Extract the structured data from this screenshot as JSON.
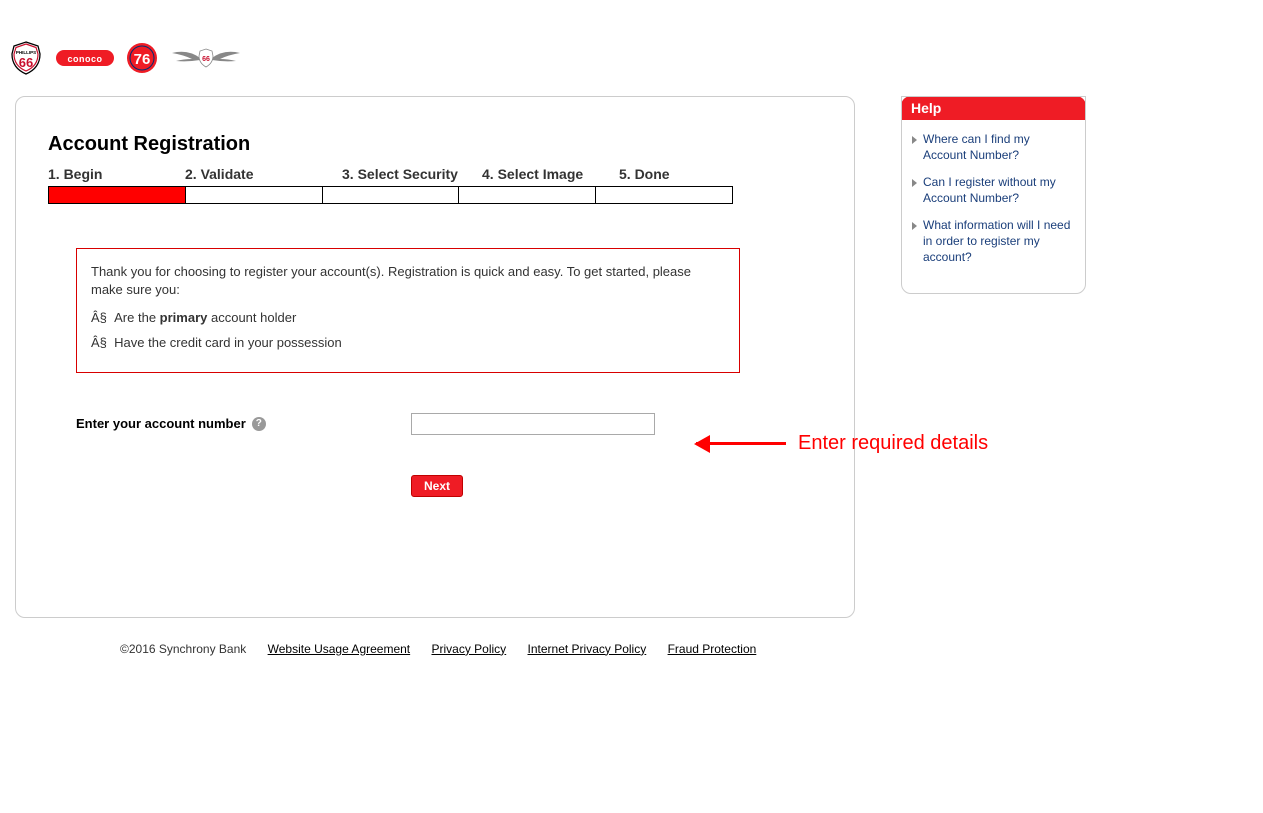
{
  "logos": {
    "phillips66_alt": "Phillips 66",
    "conoco_alt": "Conoco",
    "seventysix_alt": "76",
    "wings_alt": "Phillips 66 Aviation"
  },
  "page": {
    "title": "Account Registration"
  },
  "steps": {
    "items": [
      {
        "label": "1. Begin"
      },
      {
        "label": "2. Validate"
      },
      {
        "label": "3. Select Security"
      },
      {
        "label": "4. Select Image"
      },
      {
        "label": "5. Done"
      }
    ],
    "active_index": 0
  },
  "info": {
    "intro": "Thank you for choosing to register your account(s). Registration is quick and easy. To get started, please make sure you:",
    "bullet_prefix": "Â§",
    "item1_pre": "Are the ",
    "item1_bold": "primary",
    "item1_post": " account holder",
    "item2": "Have the credit card in your possession"
  },
  "form": {
    "account_label": "Enter your account number",
    "account_value": "",
    "next_label": "Next"
  },
  "help": {
    "title": "Help",
    "links": [
      {
        "text": "Where can I find my Account Number?"
      },
      {
        "text": "Can I register without my Account Number?"
      },
      {
        "text": "What information will I need in order to register my account?"
      }
    ]
  },
  "footer": {
    "copyright": "©2016 Synchrony Bank",
    "links": [
      {
        "text": "Website Usage Agreement"
      },
      {
        "text": "Privacy Policy"
      },
      {
        "text": "Internet Privacy Policy"
      },
      {
        "text": "Fraud Protection"
      }
    ]
  },
  "annotation": {
    "text": "Enter required details"
  }
}
